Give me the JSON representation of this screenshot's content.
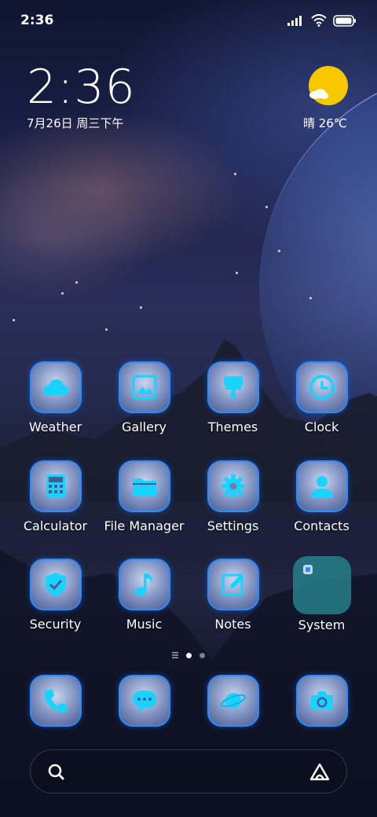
{
  "status_bar": {
    "time": "2:36"
  },
  "widget": {
    "time": "2:36",
    "date": "7月26日 周三下午",
    "weather": "晴 26℃"
  },
  "apps": [
    {
      "label": "Weather",
      "icon": "cloud-icon"
    },
    {
      "label": "Gallery",
      "icon": "image-icon"
    },
    {
      "label": "Themes",
      "icon": "paintbrush-icon"
    },
    {
      "label": "Clock",
      "icon": "clock-icon"
    },
    {
      "label": "Calculator",
      "icon": "calculator-icon"
    },
    {
      "label": "File Manager",
      "icon": "folder-icon"
    },
    {
      "label": "Settings",
      "icon": "gear-icon"
    },
    {
      "label": "Contacts",
      "icon": "person-icon"
    },
    {
      "label": "Security",
      "icon": "shield-check-icon"
    },
    {
      "label": "Music",
      "icon": "music-note-icon"
    },
    {
      "label": "Notes",
      "icon": "pencil-square-icon"
    },
    {
      "label": "System",
      "icon": "folder-group-icon"
    }
  ],
  "dock": [
    {
      "icon": "phone-icon"
    },
    {
      "icon": "message-icon"
    },
    {
      "icon": "browser-planet-icon"
    },
    {
      "icon": "camera-icon"
    }
  ],
  "colors": {
    "icon_accent": "#19d3ff",
    "tile_border": "#2a8cff",
    "sun": "#f7c800"
  }
}
